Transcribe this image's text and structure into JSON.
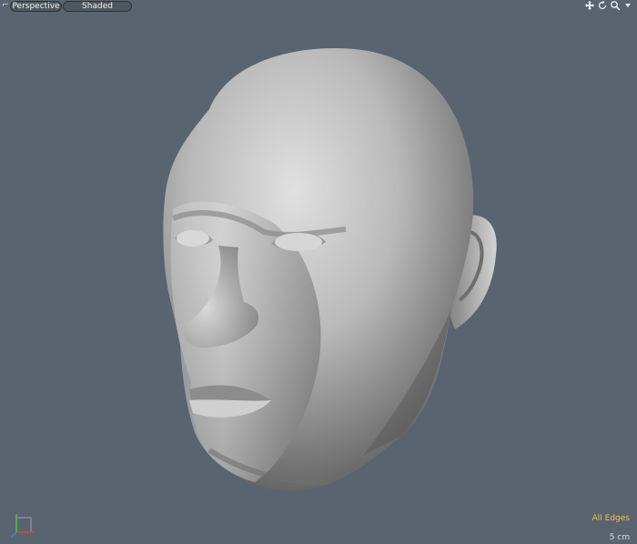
{
  "viewport": {
    "projection_label": "Perspective",
    "shading_label": "Shaded",
    "edges_label": "All Edges",
    "scale_label": "5 cm",
    "corner_glyph": "⌐"
  },
  "nav_icons": [
    "move-icon",
    "rotate-icon",
    "zoom-icon",
    "menu-arrow-icon"
  ],
  "colors": {
    "background": "#5a6470",
    "accent_text": "#f0c43a"
  }
}
